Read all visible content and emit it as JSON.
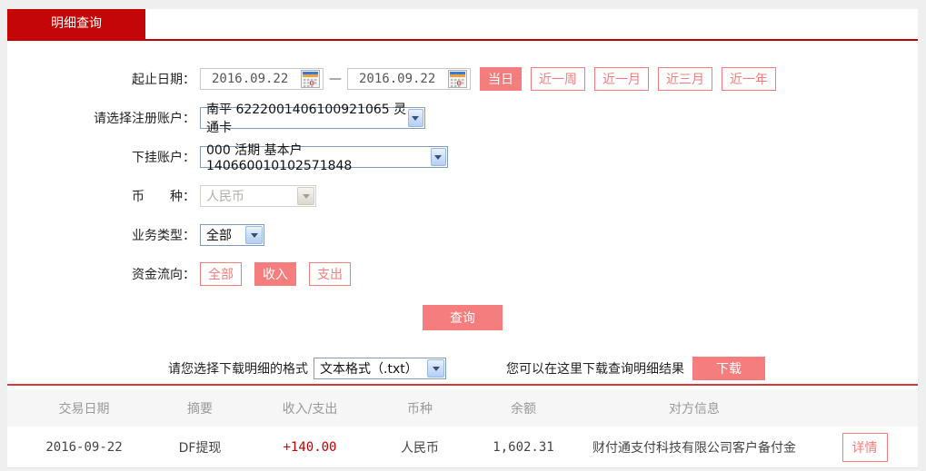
{
  "colors": {
    "tab_red": "#c50606",
    "tab_underline_red": "#c00000",
    "salmon_accent": "#f57d7d",
    "table_topline_red": "#d03a3a",
    "amount_red": "#c00000",
    "header_text_gray": "#999999"
  },
  "icons": {
    "calendar-icon": "calendar-grid",
    "chevron-down-icon": "▼"
  },
  "tab": {
    "label": "明细查询"
  },
  "form": {
    "date_range": {
      "label": "起止日期：",
      "start": "2016.09.22",
      "end": "2016.09.22",
      "separator": "—",
      "quick_buttons": [
        {
          "label": "当日",
          "active": true
        },
        {
          "label": "近一周",
          "active": false
        },
        {
          "label": "近一月",
          "active": false
        },
        {
          "label": "近三月",
          "active": false
        },
        {
          "label": "近一年",
          "active": false
        }
      ]
    },
    "registered_account": {
      "label": "请选择注册账户：",
      "value": "南平 6222001406100921065 灵通卡"
    },
    "sub_account": {
      "label": "下挂账户：",
      "value": "000 活期 基本户 140660010102571848"
    },
    "currency": {
      "label": "币　　种：",
      "value": "人民币",
      "disabled": true
    },
    "business_type": {
      "label": "业务类型：",
      "value": "全部"
    },
    "fund_flow": {
      "label": "资金流向：",
      "options": [
        {
          "label": "全部",
          "active": false
        },
        {
          "label": "收入",
          "active": true
        },
        {
          "label": "支出",
          "active": false
        }
      ]
    },
    "query_button": "查询"
  },
  "download": {
    "format_label": "请您选择下载明细的格式",
    "format_value": "文本格式（.txt）",
    "hint": "您可以在这里下载查询明细结果",
    "button": "下载"
  },
  "table": {
    "headers": [
      "交易日期",
      "摘要",
      "收入/支出",
      "币种",
      "余额",
      "对方信息"
    ],
    "rows": [
      {
        "date": "2016-09-22",
        "summary": "DF提现",
        "amount": "+140.00",
        "currency": "人民币",
        "balance": "1,602.31",
        "counterparty": "财付通支付科技有限公司客户备付金",
        "action": "详情"
      }
    ]
  }
}
